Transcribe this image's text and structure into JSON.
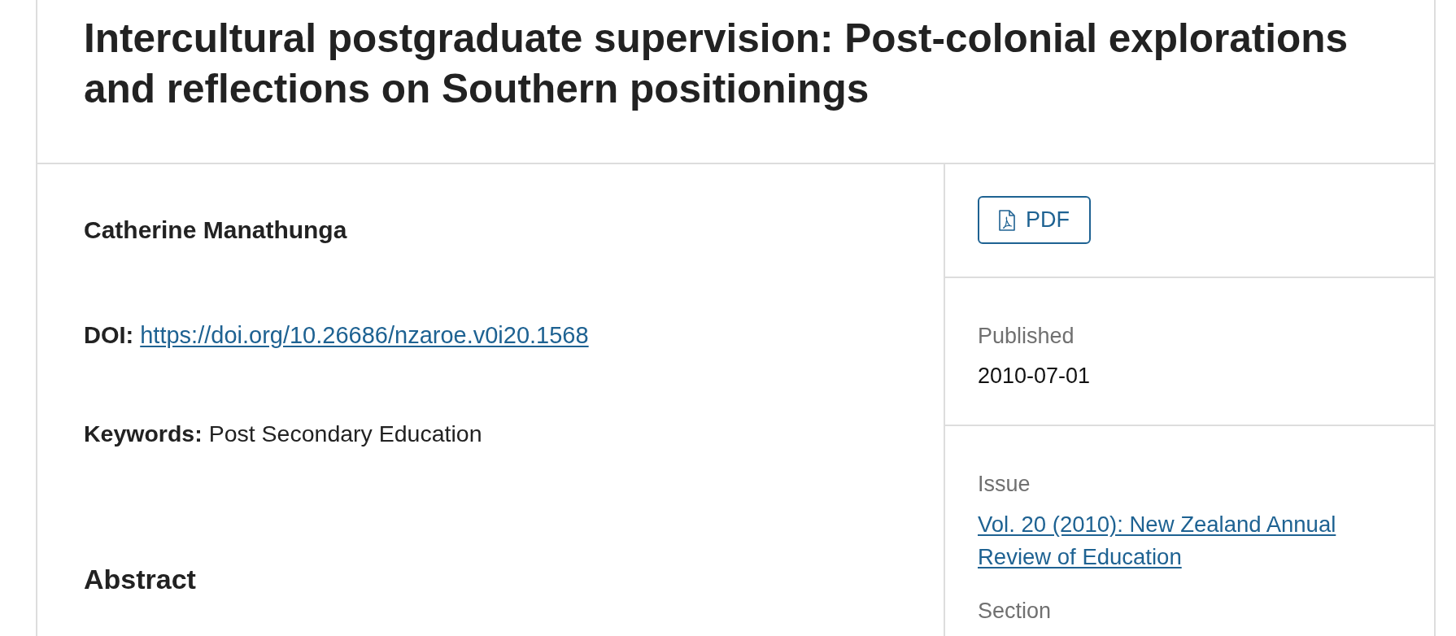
{
  "article": {
    "title": "Intercultural postgraduate supervision: Post-colonial explorations and reflections on Southern positionings"
  },
  "main": {
    "authors": [
      "Catherine Manathunga"
    ],
    "doi": {
      "label": "DOI:",
      "link": "https://doi.org/10.26686/nzaroe.v0i20.1568"
    },
    "keywords": {
      "label": "Keywords:",
      "value": "Post Secondary Education"
    },
    "abstract_heading": "Abstract"
  },
  "sidebar": {
    "galleys": [
      {
        "label": "PDF"
      }
    ],
    "blocks": [
      {
        "entries": [
          {
            "kind": "text",
            "label": "Published",
            "value": "2010-07-01"
          }
        ]
      },
      {
        "entries": [
          {
            "kind": "link",
            "label": "Issue",
            "value": "Vol. 20 (2010): New Zealand Annual Review of Education"
          },
          {
            "kind": "text",
            "label": "Section"
          }
        ]
      }
    ]
  }
}
